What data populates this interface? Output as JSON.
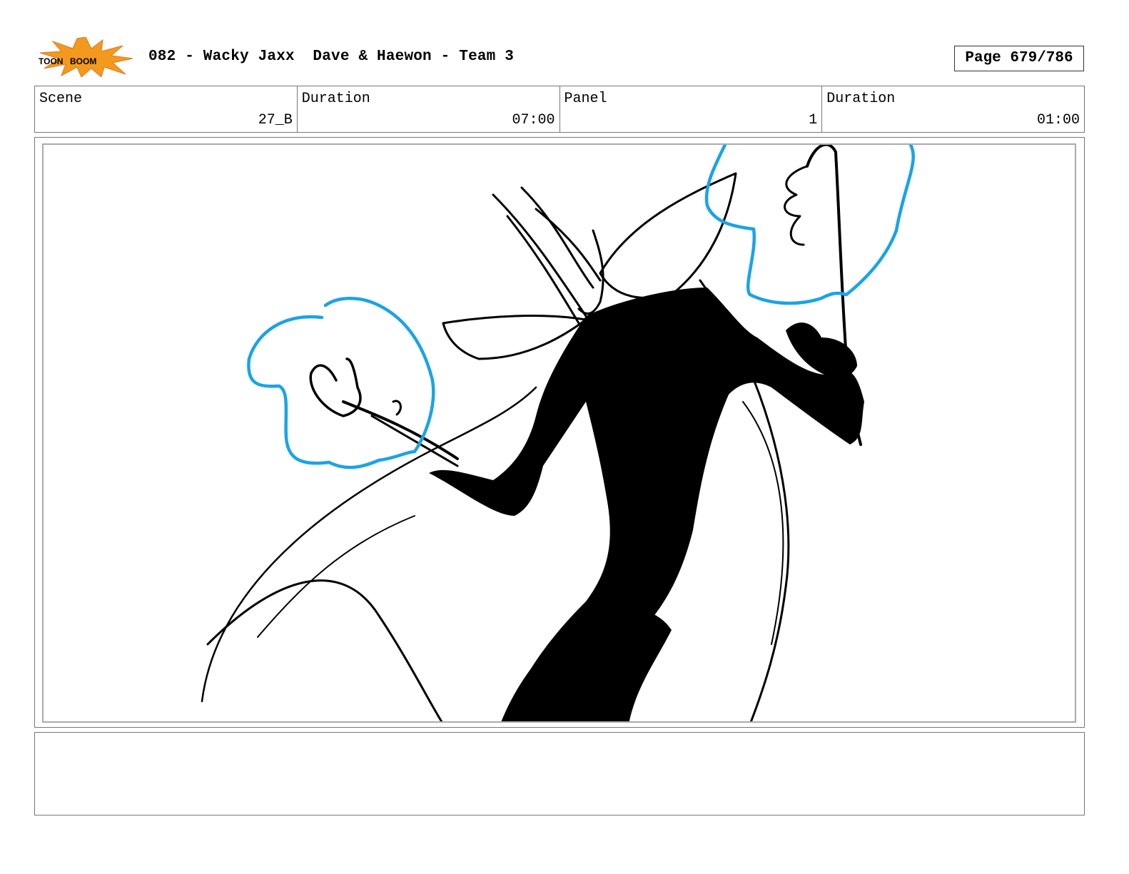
{
  "header": {
    "logo_text_left": "TOON",
    "logo_text_right": "BOOM",
    "title": "082 - Wacky Jaxx  Dave & Haewon - Team 3",
    "page": "Page 679/786"
  },
  "info": {
    "scene_label": "Scene",
    "scene_value": "27_B",
    "scene_duration_label": "Duration",
    "scene_duration_value": "07:00",
    "panel_label": "Panel",
    "panel_value": "1",
    "panel_duration_label": "Duration",
    "panel_duration_value": "01:00"
  },
  "notes": {
    "text": ""
  },
  "colors": {
    "sketch_line": "#000000",
    "annotation_blue": "#1aa3e8",
    "logo_orange": "#f39a1e"
  }
}
